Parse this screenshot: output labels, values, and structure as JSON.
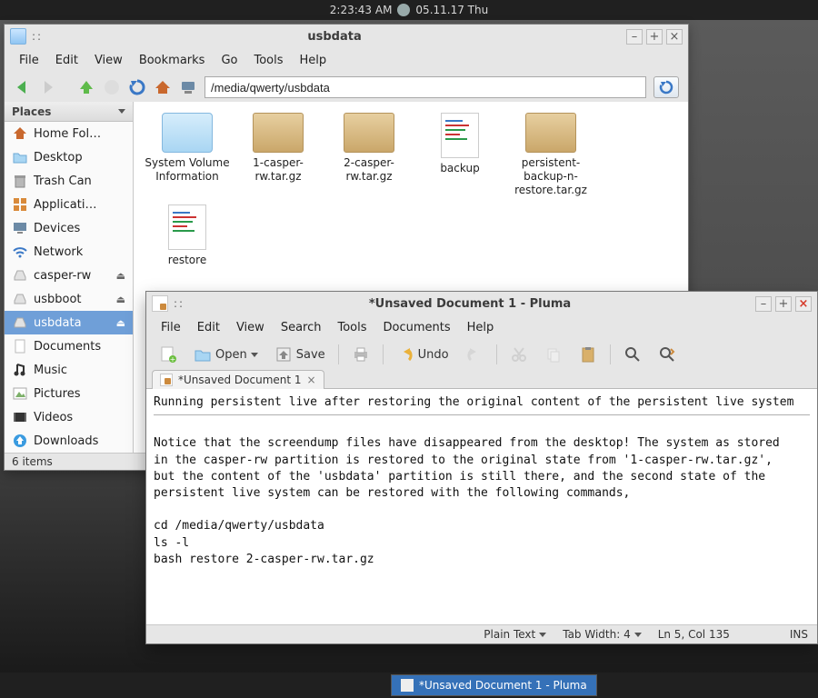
{
  "topbar": {
    "time": "2:23:43 AM",
    "date": "05.11.17 Thu"
  },
  "taskbar": {
    "item_label": "*Unsaved Document 1 - Pluma"
  },
  "fm": {
    "title": "usbdata",
    "menus": [
      "File",
      "Edit",
      "View",
      "Bookmarks",
      "Go",
      "Tools",
      "Help"
    ],
    "path": "/media/qwerty/usbdata",
    "places_header": "Places",
    "places": [
      {
        "label": "Home Fol…",
        "icon": "home",
        "eject": false,
        "selected": false
      },
      {
        "label": "Desktop",
        "icon": "folder",
        "eject": false,
        "selected": false
      },
      {
        "label": "Trash Can",
        "icon": "trash",
        "eject": false,
        "selected": false
      },
      {
        "label": "Applicati…",
        "icon": "apps",
        "eject": false,
        "selected": false
      },
      {
        "label": "Devices",
        "icon": "monitor",
        "eject": false,
        "selected": false
      },
      {
        "label": "Network",
        "icon": "wifi",
        "eject": false,
        "selected": false
      },
      {
        "label": "casper-rw",
        "icon": "drive",
        "eject": true,
        "selected": false
      },
      {
        "label": "usbboot",
        "icon": "drive",
        "eject": true,
        "selected": false
      },
      {
        "label": "usbdata",
        "icon": "drive",
        "eject": true,
        "selected": true
      },
      {
        "label": "Documents",
        "icon": "page",
        "eject": false,
        "selected": false
      },
      {
        "label": "Music",
        "icon": "music",
        "eject": false,
        "selected": false
      },
      {
        "label": "Pictures",
        "icon": "pictures",
        "eject": false,
        "selected": false
      },
      {
        "label": "Videos",
        "icon": "video",
        "eject": false,
        "selected": false
      },
      {
        "label": "Downloads",
        "icon": "download",
        "eject": false,
        "selected": false
      }
    ],
    "items": [
      {
        "label": "System Volume Information",
        "type": "folder"
      },
      {
        "label": "1-casper-rw.tar.gz",
        "type": "archive"
      },
      {
        "label": "2-casper-rw.tar.gz",
        "type": "archive"
      },
      {
        "label": "backup",
        "type": "text"
      },
      {
        "label": "persistent-backup-n-restore.tar.gz",
        "type": "archive"
      },
      {
        "label": "restore",
        "type": "text"
      }
    ],
    "status": "6 items"
  },
  "ed": {
    "title": "*Unsaved Document 1 - Pluma",
    "menus": [
      "File",
      "Edit",
      "View",
      "Search",
      "Tools",
      "Documents",
      "Help"
    ],
    "tb": {
      "open": "Open",
      "save": "Save",
      "undo": "Undo"
    },
    "tab_label": "*Unsaved Document 1",
    "text_line1": "Running persistent live after restoring the original content of the persistent live system",
    "text_body": "Notice that the screendump files have disappeared from the desktop! The system as stored\nin the casper-rw partition is restored to the original state from '1-casper-rw.tar.gz',\nbut the content of the 'usbdata' partition is still there, and the second state of the\npersistent live system can be restored with the following commands,\n\ncd /media/qwerty/usbdata\nls -l\nbash restore 2-casper-rw.tar.gz",
    "status": {
      "lang": "Plain Text",
      "tabwidth": "Tab Width: 4",
      "pos": "Ln 5, Col 135",
      "mode": "INS"
    }
  }
}
